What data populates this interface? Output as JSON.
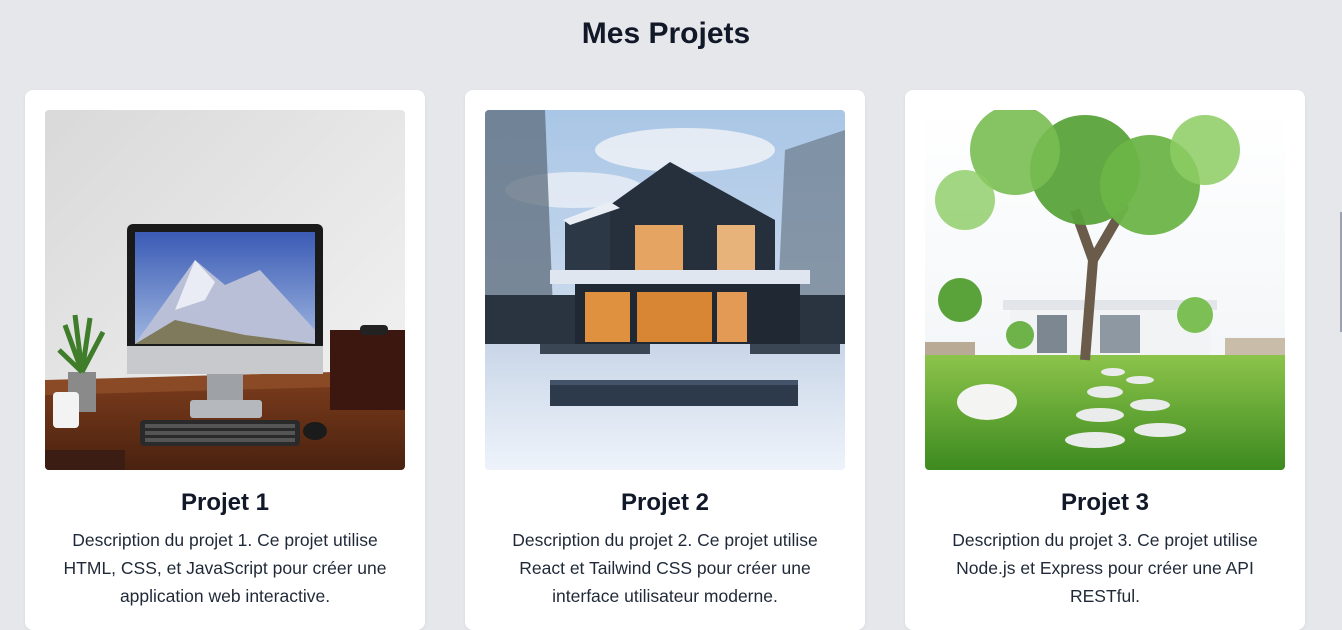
{
  "page": {
    "title": "Mes Projets"
  },
  "projects": [
    {
      "title": "Projet 1",
      "description": "Description du projet 1. Ce projet utilise HTML, CSS, et JavaScript pour créer une application web interactive.",
      "image_icon": "desktop-computer-image"
    },
    {
      "title": "Projet 2",
      "description": "Description du projet 2. Ce projet utilise React et Tailwind CSS pour créer une interface utilisateur moderne.",
      "image_icon": "modern-house-snow-image"
    },
    {
      "title": "Projet 3",
      "description": "Description du projet 3. Ce projet utilise Node.js et Express pour créer une API RESTful.",
      "image_icon": "garden-tree-house-image"
    }
  ],
  "colors": {
    "background": "#e5e7eb",
    "card": "#ffffff",
    "text": "#111827"
  }
}
